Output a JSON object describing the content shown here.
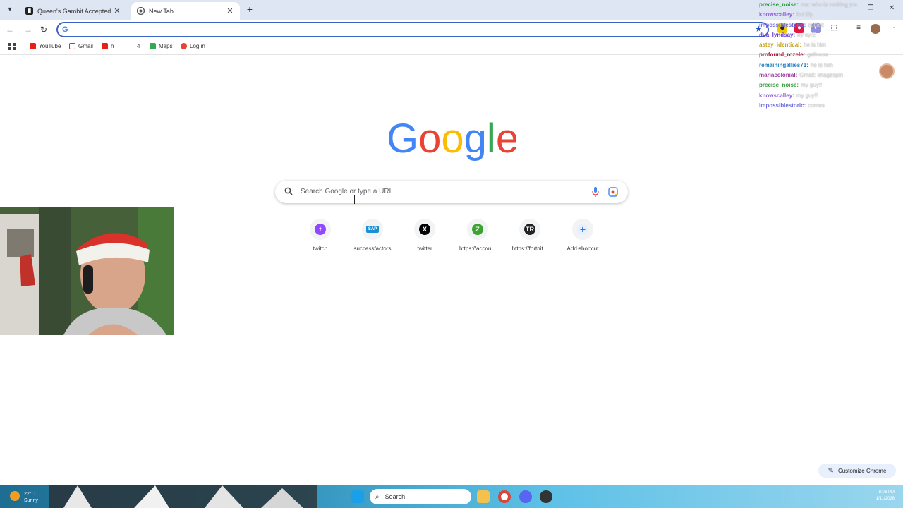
{
  "browser": {
    "tabs": [
      {
        "title": "Queen's Gambit Accepted | Ch",
        "active": false
      },
      {
        "title": "New Tab",
        "active": true
      }
    ],
    "bookmarks": [
      {
        "label": "YouTube",
        "color": "#e62117"
      },
      {
        "label": "Gmail",
        "color": "#d93025"
      },
      {
        "label": "h",
        "color": "#e62117"
      },
      {
        "label": "4",
        "color": "#ffffff"
      },
      {
        "label": "Maps",
        "color": "#34a853"
      },
      {
        "label": "Log in",
        "color": "#ea4335"
      }
    ]
  },
  "ntp": {
    "logo_text": "Google",
    "search_placeholder": "Search Google or type a URL",
    "shortcuts": [
      {
        "label": "twitch",
        "icon": "twitch-icon",
        "color": "#9146ff",
        "glyph": "t"
      },
      {
        "label": "successfactors",
        "icon": "sap-icon",
        "color": "#1a8fd6",
        "glyph": "SAP"
      },
      {
        "label": "twitter",
        "icon": "x-icon",
        "color": "#000000",
        "glyph": "X"
      },
      {
        "label": "https://accou...",
        "icon": "letter-z-icon",
        "color": "#3ba330",
        "glyph": "Z"
      },
      {
        "label": "https://fortnit...",
        "icon": "fortnite-icon",
        "color": "#222222",
        "glyph": "TR"
      },
      {
        "label": "Add shortcut",
        "icon": "plus-icon",
        "color": "#e8f0fe",
        "glyph": "+"
      }
    ],
    "customize_label": "Customize Chrome"
  },
  "chat": [
    {
      "user": "precise_noise:",
      "message": "ma: who is ranking me",
      "color": "#2e9e3a"
    },
    {
      "user": "knowscalley:",
      "message": "fori:lify",
      "color": "#8a5cd6"
    },
    {
      "user": "impossiblestoric:",
      "message": "cofficit",
      "color": "#6e6ee0"
    },
    {
      "user": "dua_lyndsay:",
      "message": "ey ey:E",
      "color": "#6a3fd0"
    },
    {
      "user": "astey_identical:",
      "message": "he is him",
      "color": "#c5a012"
    },
    {
      "user": "profound_rozele:",
      "message": "gellnese",
      "color": "#b01f3a"
    },
    {
      "user": "remainingallies71:",
      "message": "he is him",
      "color": "#1f7fbf"
    },
    {
      "user": "mariacolonial:",
      "message": "Gmail: imagespin",
      "color": "#9b3aa0"
    },
    {
      "user": "precise_noise:",
      "message": "my guy!!",
      "color": "#2e9e3a"
    },
    {
      "user": "knowscalley:",
      "message": "my guy!!",
      "color": "#8a5cd6"
    },
    {
      "user": "impossiblestoric:",
      "message": "comes",
      "color": "#6e6ee0"
    }
  ],
  "taskbar": {
    "weather_temp": "22°C",
    "weather_desc": "Sunny",
    "search_label": "Search",
    "time": "8:06 PM",
    "date": "1/11/2026"
  }
}
